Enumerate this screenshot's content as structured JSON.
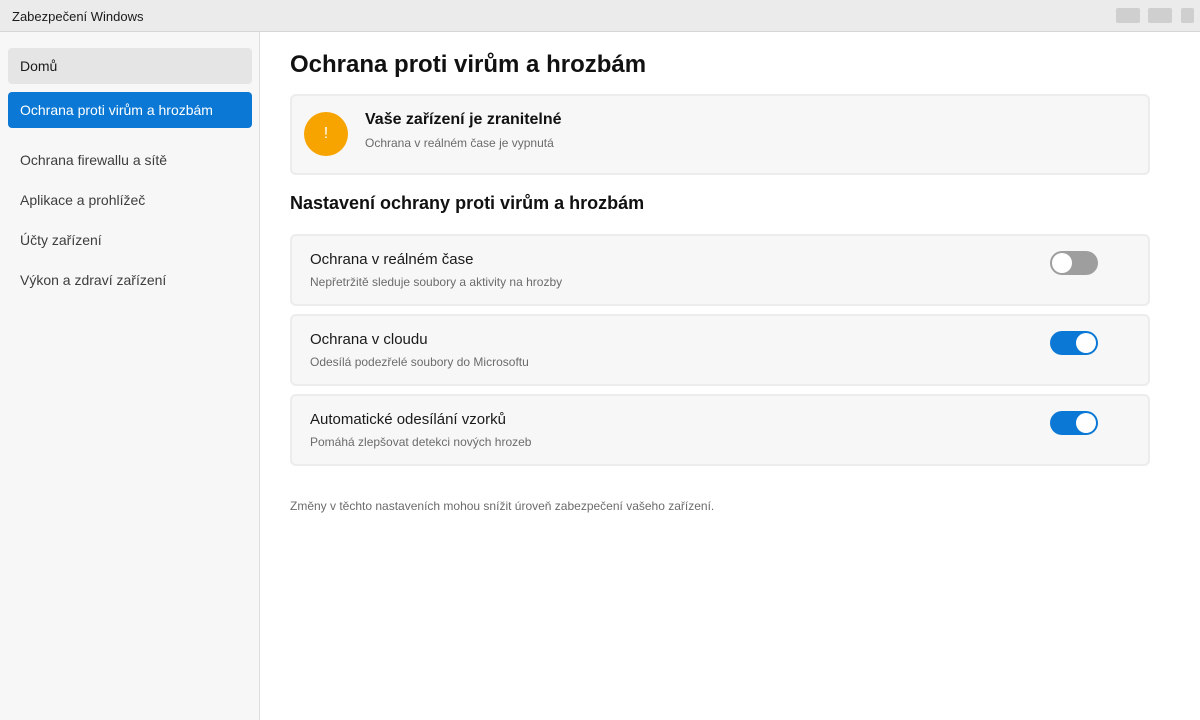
{
  "window": {
    "title": "Zabezpečení Windows"
  },
  "sidebar": {
    "items": [
      {
        "label": "Domů"
      },
      {
        "label": "Ochrana proti virům a hrozbám"
      },
      {
        "label": "Ochrana firewallu a sítě"
      },
      {
        "label": "Aplikace a prohlížeč"
      },
      {
        "label": "Účty zařízení"
      },
      {
        "label": "Výkon a zdraví zařízení"
      }
    ],
    "active_index": 1
  },
  "main": {
    "title": "Ochrana proti virům a hrozbám",
    "alert": {
      "icon": "warning-icon",
      "icon_glyph": "!",
      "title": "Vaše zařízení je zranitelné",
      "subtitle": "Ochrana v reálném čase je vypnutá"
    },
    "settings_title": "Nastavení ochrany proti virům a hrozbám",
    "settings": [
      {
        "title": "Ochrana v reálném čase",
        "description": "Nepřetržitě sleduje soubory a aktivity na hrozby",
        "enabled": false
      },
      {
        "title": "Ochrana v cloudu",
        "description": "Odesílá podezřelé soubory do Microsoftu",
        "enabled": true
      },
      {
        "title": "Automatické odesílání vzorků",
        "description": "Pomáhá zlepšovat detekci nových hrozeb",
        "enabled": true
      }
    ],
    "footer_note": "Změny v těchto nastaveních mohou snížit úroveň zabezpečení vašeho zařízení."
  },
  "colors": {
    "accent": "#0a78d4",
    "warning": "#f7a400",
    "toggle_off": "#9e9e9e"
  }
}
